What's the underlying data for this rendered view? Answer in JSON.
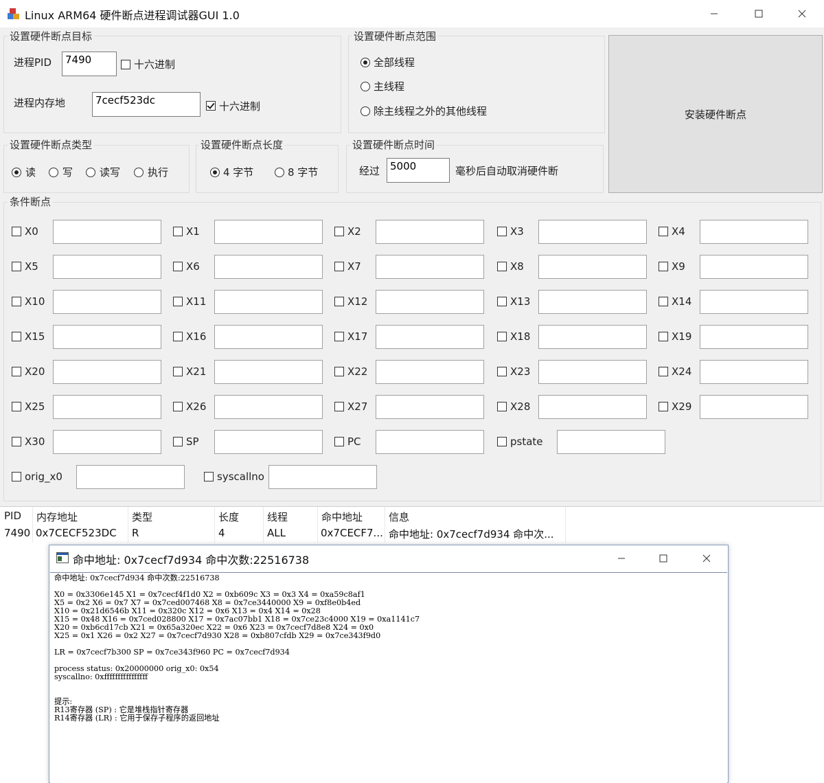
{
  "window": {
    "title": "Linux ARM64 硬件断点进程调试器GUI 1.0"
  },
  "target": {
    "group_label": "设置硬件断点目标",
    "pid_label": "进程PID",
    "pid_value": "7490",
    "pid_hex_label": "十六进制",
    "pid_hex_checked": false,
    "addr_label": "进程内存地",
    "addr_value": "7cecf523dc",
    "addr_hex_label": "十六进制",
    "addr_hex_checked": true
  },
  "scope": {
    "group_label": "设置硬件断点范围",
    "options": [
      "全部线程",
      "主线程",
      "除主线程之外的其他线程"
    ],
    "selected": 0
  },
  "install_button": "安装硬件断点",
  "type": {
    "group_label": "设置硬件断点类型",
    "options": [
      "读",
      "写",
      "读写",
      "执行"
    ],
    "selected": 0
  },
  "length": {
    "group_label": "设置硬件断点长度",
    "options": [
      "4 字节",
      "8 字节"
    ],
    "selected": 0
  },
  "time": {
    "group_label": "设置硬件断点时间",
    "prefix": "经过",
    "value": "5000",
    "suffix": "毫秒后自动取消硬件断"
  },
  "conditions": {
    "group_label": "条件断点",
    "registers": [
      "X0",
      "X1",
      "X2",
      "X3",
      "X4",
      "X5",
      "X6",
      "X7",
      "X8",
      "X9",
      "X10",
      "X11",
      "X12",
      "X13",
      "X14",
      "X15",
      "X16",
      "X17",
      "X18",
      "X19",
      "X20",
      "X21",
      "X22",
      "X23",
      "X24",
      "X25",
      "X26",
      "X27",
      "X28",
      "X29",
      "X30",
      "SP",
      "PC",
      "pstate"
    ],
    "extra": [
      "orig_x0",
      "syscallno"
    ]
  },
  "table": {
    "columns": [
      "PID",
      "内存地址",
      "类型",
      "长度",
      "线程",
      "命中地址",
      "信息"
    ],
    "rows": [
      [
        "7490",
        "0x7CECF523DC",
        "R",
        "4",
        "ALL",
        "0x7CECF7...",
        "命中地址: 0x7cecf7d934 命中次..."
      ]
    ]
  },
  "child_window": {
    "title": "命中地址: 0x7cecf7d934 命中次数:22516738",
    "lines": [
      "命中地址: 0x7cecf7d934 命中次数:22516738",
      "",
      "X0 = 0x3306e145 X1 = 0x7cecf4f1d0 X2 = 0xb609c X3 = 0x3 X4 = 0xa59c8af1",
      "X5 = 0x2 X6 = 0x7 X7 = 0x7ced007468 X8 = 0x7ce3440000 X9 = 0xf8e0b4ed",
      "X10 = 0x21d6546b X11 = 0x320c X12 = 0x6 X13 = 0x4 X14 = 0x28",
      "X15 = 0x48 X16 = 0x7ced028800 X17 = 0x7ac07bb1 X18 = 0x7ce23c4000 X19 = 0xa1141c7",
      "X20 = 0xb6cd17cb X21 = 0x65a320ec X22 = 0x6 X23 = 0x7cecf7d8e8 X24 = 0x0",
      "X25 = 0x1 X26 = 0x2 X27 = 0x7cecf7d930 X28 = 0xb807cfdb X29 = 0x7ce343f9d0",
      "",
      "LR = 0x7cecf7b300 SP = 0x7ce343f960 PC = 0x7cecf7d934",
      "",
      "process status: 0x20000000 orig_x0: 0x54",
      "syscallno: 0xffffffffffffffff",
      "",
      "",
      "提示:",
      "R13寄存器 (SP) : 它是堆栈指针寄存器",
      "R14寄存器 (LR) : 它用于保存子程序的返回地址"
    ]
  }
}
